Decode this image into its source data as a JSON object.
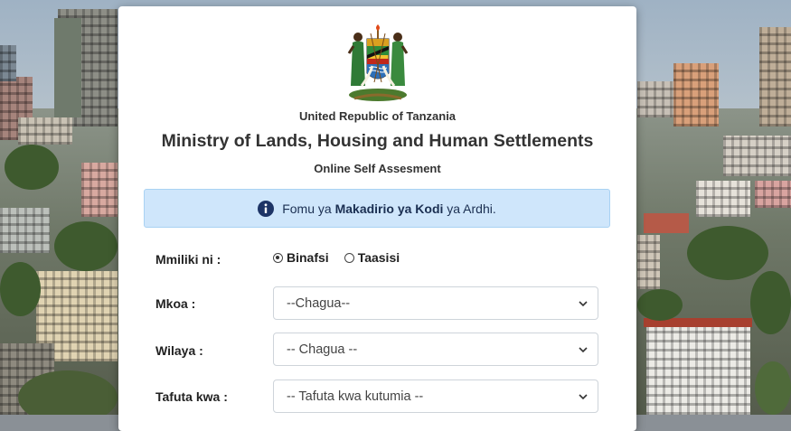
{
  "header": {
    "country": "United Republic of Tanzania",
    "ministry": "Ministry of Lands, Housing and Human Settlements",
    "subtitle": "Online Self Assesment"
  },
  "emblem": {
    "icon": "tanzania-coat-of-arms"
  },
  "alert": {
    "icon": "info-circle-icon",
    "prefix": "Fomu ya",
    "bold": "Makadirio ya Kodi",
    "suffix": "ya Ardhi.",
    "colors": {
      "background": "#cfe6fb",
      "text": "#1b2f52"
    }
  },
  "form": {
    "owner": {
      "label": "Mmiliki ni :",
      "options": [
        {
          "label": "Binafsi",
          "selected": true
        },
        {
          "label": "Taasisi",
          "selected": false
        }
      ]
    },
    "region": {
      "label": "Mkoa :",
      "value": "--Chagua--"
    },
    "district": {
      "label": "Wilaya :",
      "value": "-- Chagua --"
    },
    "search_by": {
      "label": "Tafuta kwa :",
      "value": "-- Tafuta kwa kutumia --"
    }
  }
}
